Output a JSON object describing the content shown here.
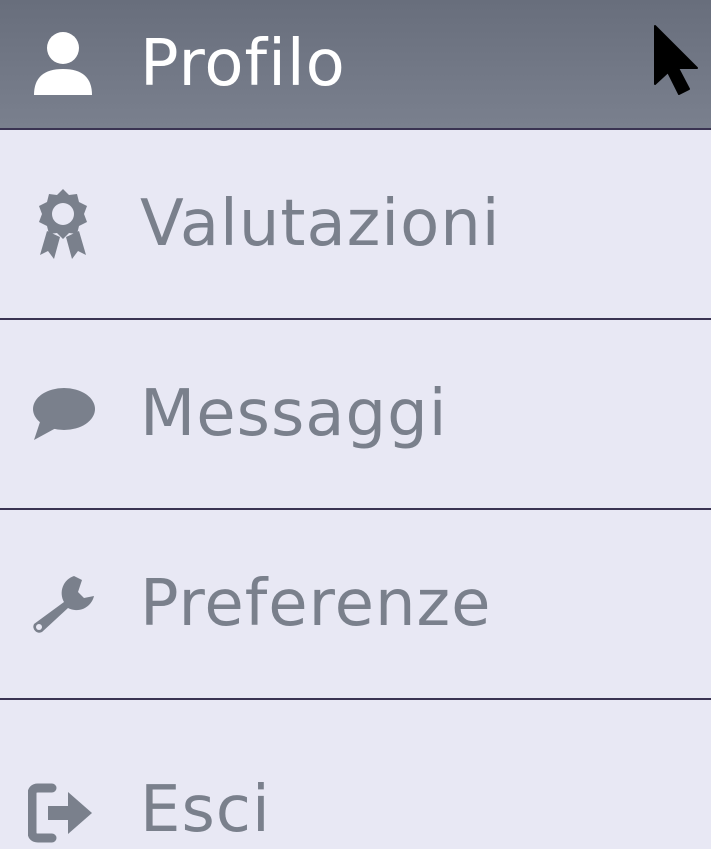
{
  "menu": {
    "items": [
      {
        "label": "Profilo",
        "icon": "user-icon",
        "active": true
      },
      {
        "label": "Valutazioni",
        "icon": "award-icon",
        "active": false
      },
      {
        "label": "Messaggi",
        "icon": "comment-icon",
        "active": false
      },
      {
        "label": "Preferenze",
        "icon": "wrench-icon",
        "active": false
      },
      {
        "label": "Esci",
        "icon": "sign-out-icon",
        "active": false
      }
    ]
  },
  "colors": {
    "active_bg": "#70768a",
    "item_bg": "#e8e8f4",
    "divider": "#3a3352",
    "label_inactive": "#7a808c",
    "label_active": "#ffffff"
  }
}
